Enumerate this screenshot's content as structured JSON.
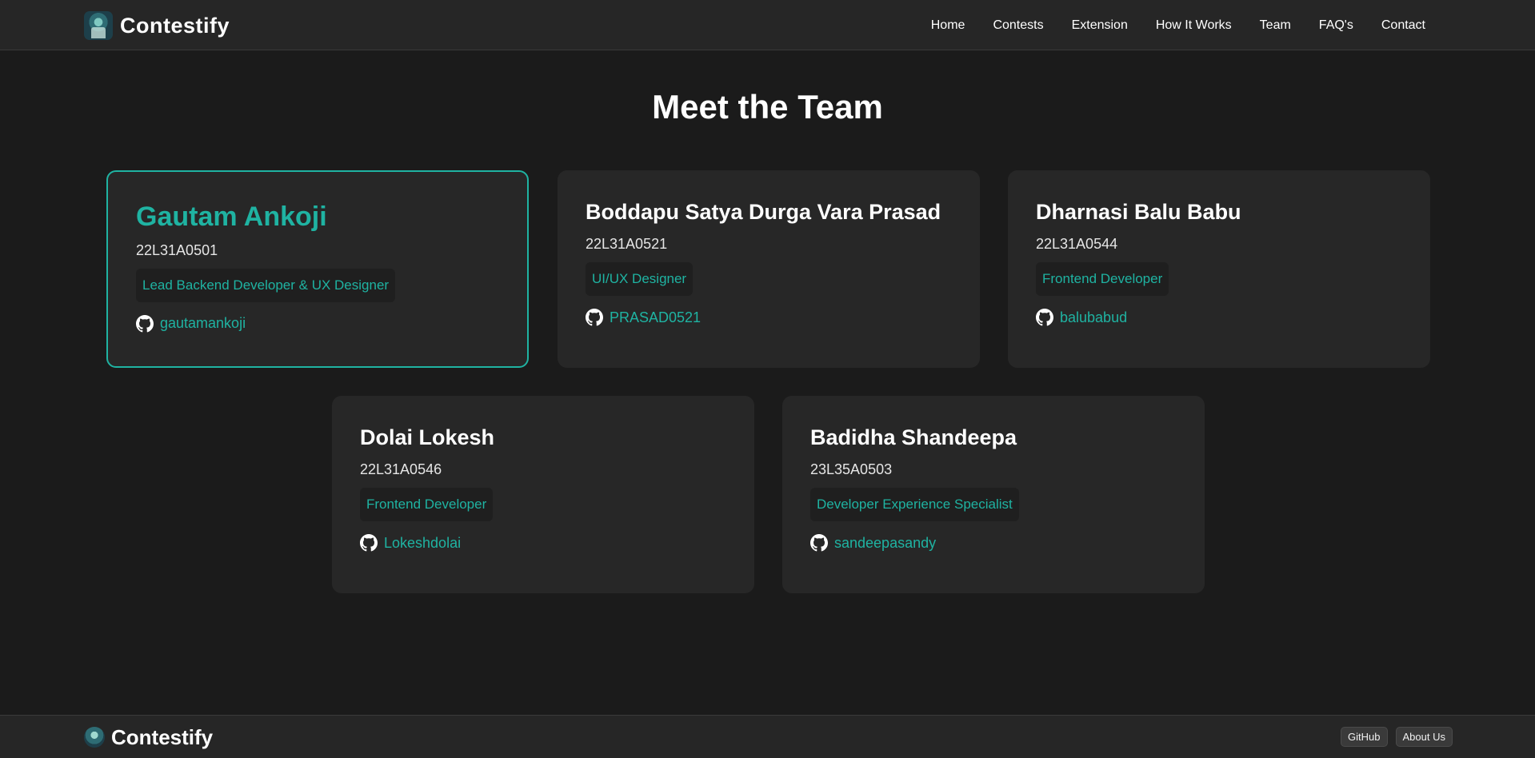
{
  "header": {
    "brand": "Contestify",
    "nav": [
      "Home",
      "Contests",
      "Extension",
      "How It Works",
      "Team",
      "FAQ's",
      "Contact"
    ]
  },
  "main": {
    "title": "Meet the Team",
    "members": [
      {
        "name": "Gautam Ankoji",
        "id": "22L31A0501",
        "role": "Lead Backend Developer & UX Designer",
        "github": "gautamankoji"
      },
      {
        "name": "Boddapu Satya Durga Vara Prasad",
        "id": "22L31A0521",
        "role": "UI/UX Designer",
        "github": "PRASAD0521"
      },
      {
        "name": "Dharnasi Balu Babu",
        "id": "22L31A0544",
        "role": "Frontend Developer",
        "github": "balubabud"
      },
      {
        "name": "Dolai Lokesh",
        "id": "22L31A0546",
        "role": "Frontend Developer",
        "github": "Lokeshdolai"
      },
      {
        "name": "Badidha Shandeepa",
        "id": "23L35A0503",
        "role": "Developer Experience Specialist",
        "github": "sandeepasandy"
      }
    ]
  },
  "footer": {
    "brand": "Contestify",
    "links": [
      "GitHub",
      "About Us"
    ]
  },
  "colors": {
    "accent": "#1fb3a2",
    "background": "#1b1b1b",
    "card": "#272727"
  }
}
